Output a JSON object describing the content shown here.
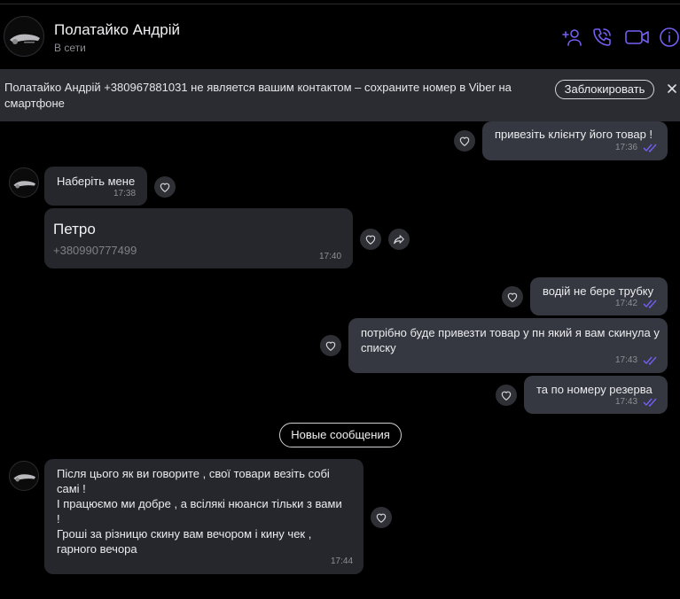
{
  "header": {
    "contact_name": "Полатайко Андрій",
    "status": "В сети",
    "icons": [
      "add-contact-icon",
      "phone-icon",
      "video-icon",
      "info-icon"
    ]
  },
  "banner": {
    "text": "Полатайко Андрій +380967881031 не является вашим контактом – сохраните номер в Viber на смартфоне",
    "block_label": "Заблокировать"
  },
  "messages": [
    {
      "dir": "out",
      "text": "привезіть клієнту його товар !",
      "time": "17:36",
      "read": true
    },
    {
      "dir": "in",
      "text": "Наберіть мене",
      "time": "17:38"
    },
    {
      "dir": "in",
      "type": "contact",
      "contact_name": "Петро",
      "contact_phone": "+380990777499",
      "time": "17:40"
    },
    {
      "dir": "out",
      "text": "водій не бере трубку",
      "time": "17:42",
      "read": true
    },
    {
      "dir": "out",
      "text": "потрібно буде привезти товар у пн який я вам скинула у списку",
      "time": "17:43",
      "read": true
    },
    {
      "dir": "out",
      "text": "та по номеру резерва",
      "time": "17:43",
      "read": true
    },
    {
      "dir": "in",
      "text_lines": [
        "Після цього як ви говорите , свої товари везіть собі",
        "самі !",
        "І працюємо ми добре , а всілякі нюанси тільки з вами",
        "!",
        "Гроші за різницю скину вам вечором і кину чек ,",
        "гарного вечора"
      ],
      "time": "17:44"
    }
  ],
  "divider": {
    "label": "Новые сообщения"
  },
  "colors": {
    "accent": "#7360f2",
    "background": "#000000",
    "bubble_in": "#25272c",
    "bubble_out": "#353840"
  }
}
